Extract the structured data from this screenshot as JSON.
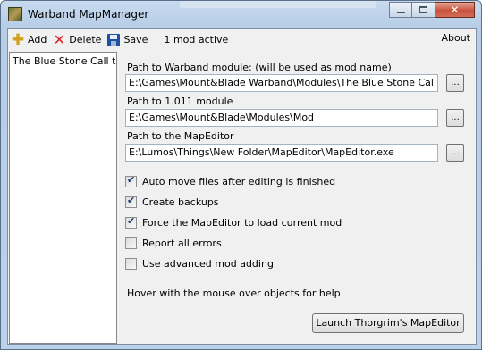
{
  "window": {
    "title": "Warband MapManager"
  },
  "toolbar": {
    "add_label": "Add",
    "delete_label": "Delete",
    "save_label": "Save",
    "status": "1 mod active",
    "about_label": "About"
  },
  "mod_list": {
    "items": [
      "The Blue Stone Call to A"
    ]
  },
  "paths": {
    "warband_label": "Path to Warband module: (will be used as mod name)",
    "warband_value": "E:\\Games\\Mount&Blade Warband\\Modules\\The Blue Stone Call to Arms",
    "module_1011_label": "Path to 1.011 module",
    "module_1011_value": "E:\\Games\\Mount&Blade\\Modules\\Mod",
    "mapeditor_label": "Path to the MapEditor",
    "mapeditor_value": "E:\\Lumos\\Things\\New Folder\\MapEditor\\MapEditor.exe",
    "browse_label": "..."
  },
  "options": [
    {
      "label": "Auto move files after editing is finished",
      "checked": true
    },
    {
      "label": "Create backups",
      "checked": true
    },
    {
      "label": "Force the MapEditor to load current mod",
      "checked": true
    },
    {
      "label": "Report all errors",
      "checked": false
    },
    {
      "label": "Use advanced mod adding",
      "checked": false
    }
  ],
  "help_text": "Hover with the mouse over objects for help",
  "launch_label": "Launch Thorgrim's MapEditor"
}
